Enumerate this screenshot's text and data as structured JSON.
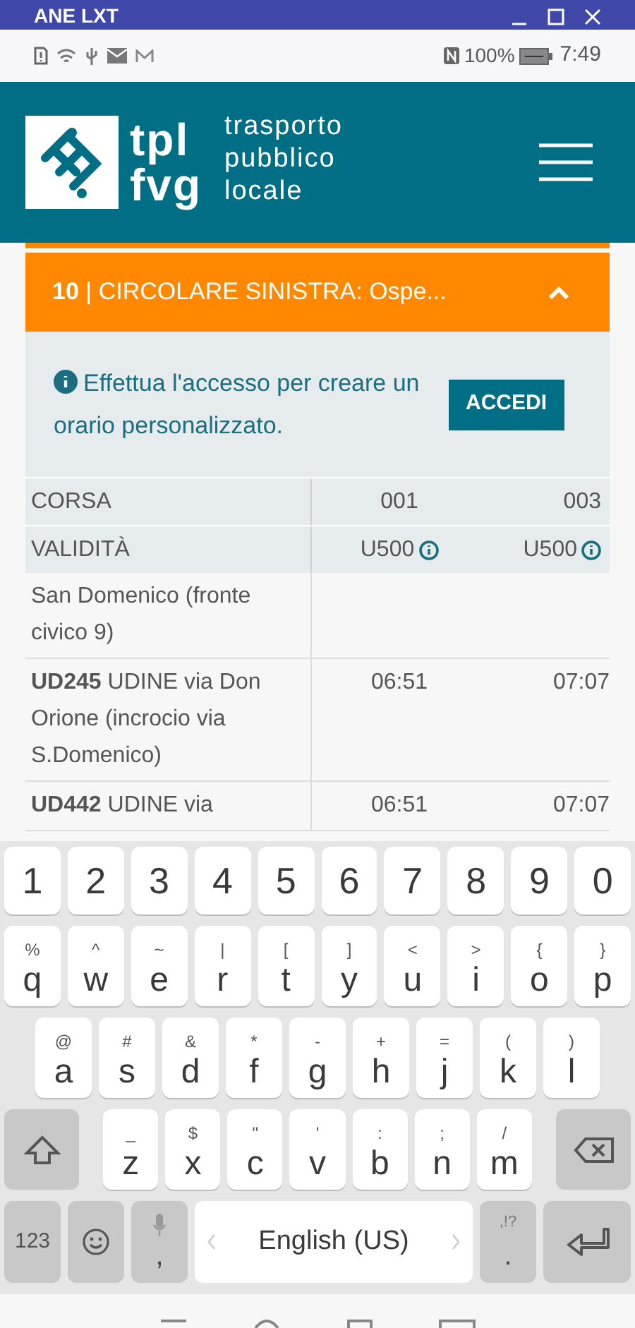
{
  "emulator_bar": {
    "title": "ANE LXT"
  },
  "status_bar": {
    "battery": "100%",
    "time": "7:49"
  },
  "header": {
    "logo_short": [
      "tpl",
      "fvg"
    ],
    "logo_long": [
      "trasporto",
      "pubblico",
      "locale"
    ]
  },
  "line_panel": {
    "number": "10",
    "separator": "|",
    "title": "CIRCOLARE SINISTRA: Ospe...",
    "expanded": true
  },
  "login_notice": {
    "text": "Effettua l'accesso per creare un orario personalizzato.",
    "button": "ACCEDI"
  },
  "table": {
    "header_rows": [
      {
        "label": "CORSA",
        "cells": [
          "001",
          "003"
        ],
        "info": false
      },
      {
        "label": "VALIDITÀ",
        "cells": [
          "U500",
          "U500"
        ],
        "info": true
      }
    ],
    "rows": [
      {
        "stop": "San Domenico (fronte civico 9)",
        "times": []
      },
      {
        "stop": "**UD245** UDINE via Don Orione (incrocio via S.Domenico)",
        "times": [
          "06:51",
          "07:07"
        ]
      },
      {
        "stop": "**UD442** UDINE via",
        "times": [
          "06:51",
          "07:07"
        ]
      }
    ]
  },
  "keyboard": {
    "number_row": [
      "1",
      "2",
      "3",
      "4",
      "5",
      "6",
      "7",
      "8",
      "9",
      "0"
    ],
    "rows": [
      [
        {
          "key": "q",
          "hint": "%"
        },
        {
          "key": "w",
          "hint": "^"
        },
        {
          "key": "e",
          "hint": "~"
        },
        {
          "key": "r",
          "hint": "|"
        },
        {
          "key": "t",
          "hint": "["
        },
        {
          "key": "y",
          "hint": "]"
        },
        {
          "key": "u",
          "hint": "<"
        },
        {
          "key": "i",
          "hint": ">"
        },
        {
          "key": "o",
          "hint": "{"
        },
        {
          "key": "p",
          "hint": "}"
        }
      ],
      [
        {
          "key": "a",
          "hint": "@"
        },
        {
          "key": "s",
          "hint": "#"
        },
        {
          "key": "d",
          "hint": "&"
        },
        {
          "key": "f",
          "hint": "*"
        },
        {
          "key": "g",
          "hint": "-"
        },
        {
          "key": "h",
          "hint": "+"
        },
        {
          "key": "j",
          "hint": "="
        },
        {
          "key": "k",
          "hint": "("
        },
        {
          "key": "l",
          "hint": ")"
        }
      ],
      [
        {
          "key": "z",
          "hint": "_"
        },
        {
          "key": "x",
          "hint": "$"
        },
        {
          "key": "c",
          "hint": "\""
        },
        {
          "key": "v",
          "hint": "'"
        },
        {
          "key": "b",
          "hint": ":"
        },
        {
          "key": "n",
          "hint": ";"
        },
        {
          "key": "m",
          "hint": "/"
        }
      ]
    ],
    "symbols_key": "123",
    "comma_key": ",",
    "space": "English (US)",
    "period_key": ".",
    "period_hint": ",!?"
  }
}
